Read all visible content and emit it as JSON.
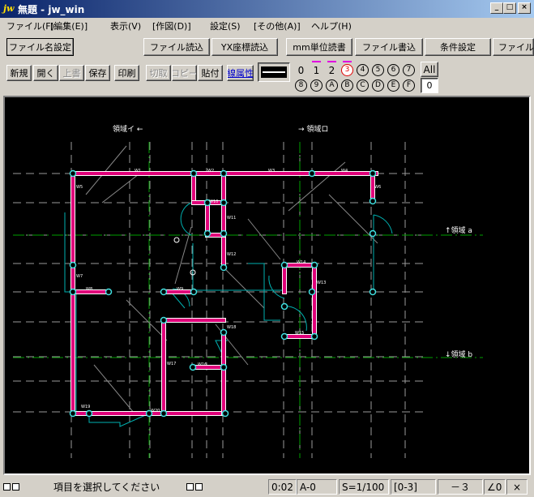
{
  "window": {
    "icon_text": "jw",
    "title": "無題 - jw_win",
    "minimize_label": "_",
    "maximize_label": "□",
    "close_label": "×"
  },
  "menu": [
    {
      "label": "ファイル(F)"
    },
    {
      "label": "[編集(E)]"
    },
    {
      "label": "表示(V)"
    },
    {
      "label": "[作図(D)]"
    },
    {
      "label": "設定(S)"
    },
    {
      "label": "[その他(A)]"
    },
    {
      "label": "ヘルプ(H)"
    }
  ],
  "toolbar1": {
    "filename_setting": "ファイル名設定",
    "file_read": "ファイル読込",
    "yx_read": "YX座標読込",
    "mm_unit_read": "mm単位読書",
    "file_write": "ファイル書込",
    "condition_setting": "条件設定",
    "file_overflow": "ファイル"
  },
  "toolbar2": {
    "new": "新規",
    "open": "開く",
    "overwrite": "上書",
    "save": "保存",
    "print": "印刷",
    "cut": "切取",
    "copy": "コピー",
    "paste": "貼付",
    "line_attr": "線属性"
  },
  "layers": {
    "row1": [
      "0",
      "1",
      "2",
      "3",
      "4",
      "5",
      "6",
      "7"
    ],
    "row2": [
      "8",
      "9",
      "A",
      "B",
      "C",
      "D",
      "E",
      "F"
    ],
    "active": "3",
    "all_label": "All",
    "group_label": "0"
  },
  "drawing": {
    "labels": {
      "area_i": "領域イ ←",
      "area_ro": "→ 領域ロ",
      "area_a": "↑領域 a",
      "area_b": "↓領域 b"
    },
    "colors": {
      "background": "#000000",
      "wall": "#e0007a",
      "wall_outline": "#ffffff",
      "grid": "#9a9a9a",
      "axis": "#00a000",
      "cyan": "#00b0b0",
      "node": "#40e0e0"
    }
  },
  "status": {
    "boxes_left": "□□",
    "message": "項目を選択してください",
    "boxes_mid": "□□",
    "layer_info": "0:02",
    "paper": "A-0",
    "scale": "S=1/100",
    "group": "[0-3]",
    "value": "－３",
    "angle": "∠0",
    "close": "×"
  }
}
